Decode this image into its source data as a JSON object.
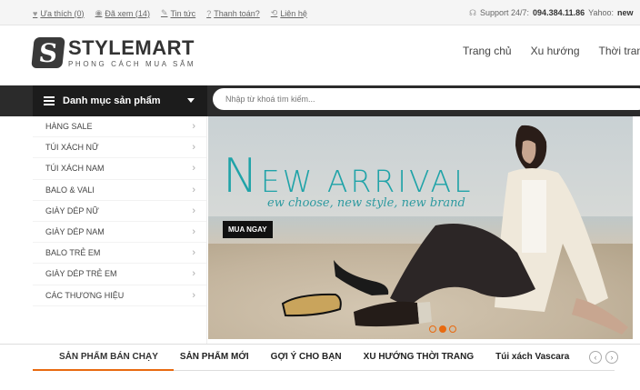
{
  "topbar": {
    "wishlist": "Ưa thích (0)",
    "viewed": "Đã xem (14)",
    "news": "Tin tức",
    "payment": "Thanh toán?",
    "contact": "Liên hệ",
    "support_label": "Support 24/7:",
    "support_phone": "094.384.11.86",
    "yahoo_label": "Yahoo:",
    "yahoo_value": "new"
  },
  "logo": {
    "mark": "S",
    "name": "STYLEMART",
    "tagline": "PHONG CÁCH MUA SẮM"
  },
  "nav": {
    "items": [
      "Trang chủ",
      "Xu hướng",
      "Thời trang"
    ]
  },
  "category_menu": {
    "label": "Danh mục sản phẩm",
    "items": [
      "HÀNG SALE",
      "TÚI XÁCH NỮ",
      "TÚI XÁCH NAM",
      "BALO & VALI",
      "GIÀY DÉP NỮ",
      "GIÀY DÉP NAM",
      "BALO TRẺ EM",
      "GIÀY DÉP TRẺ EM",
      "CÁC THƯƠNG HIỆU"
    ]
  },
  "search": {
    "placeholder": "Nhập từ khoá tìm kiếm..."
  },
  "banner": {
    "title_first": "N",
    "title_rest": "EW ARRIVAL",
    "subtitle": "ew choose, new style, new brand",
    "button": "MUA NGAY",
    "slide_count": 3,
    "active_slide": 2
  },
  "tabs": {
    "items": [
      "SẢN PHẨM BÁN CHẠY",
      "SẢN PHẨM MỚI",
      "GỢI Ý CHO BẠN",
      "XU HƯỚNG THỜI TRANG",
      "Túi xách Vascara"
    ]
  },
  "colors": {
    "accent": "#e86a10",
    "teal": "#1fa3a8",
    "dark_bar": "#2b2b2b"
  }
}
